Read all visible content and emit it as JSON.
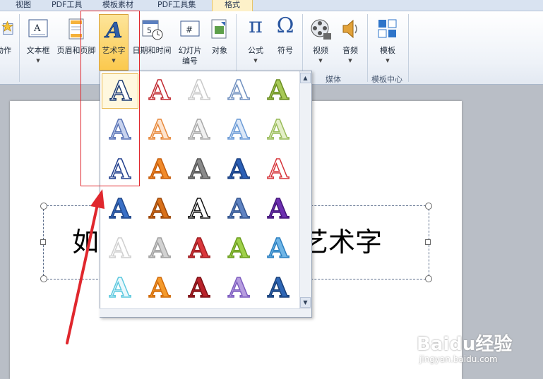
{
  "tabs": [
    {
      "label": "视图",
      "active": false
    },
    {
      "label": "PDF工具",
      "active": false
    },
    {
      "label": "模板素材",
      "active": false
    },
    {
      "label": "PDF工具集",
      "active": false
    },
    {
      "label": "格式",
      "active": true
    }
  ],
  "ribbon": {
    "partial_label": "动作",
    "buttons": [
      {
        "label": "文本框",
        "icon": "text-box-icon",
        "dropdown": true
      },
      {
        "label": "页眉和页脚",
        "icon": "header-footer-icon",
        "dropdown": false
      },
      {
        "label": "艺术字",
        "icon": "wordart-icon",
        "dropdown": true
      },
      {
        "label": "日期和时间",
        "icon": "date-time-icon",
        "dropdown": false
      },
      {
        "label": "幻灯片",
        "label2": "编号",
        "icon": "slide-number-icon",
        "dropdown": false
      },
      {
        "label": "对象",
        "icon": "object-icon",
        "dropdown": false
      },
      {
        "label": "公式",
        "icon": "equation-icon",
        "glyph": "π",
        "dropdown": true
      },
      {
        "label": "符号",
        "icon": "symbol-icon",
        "glyph": "Ω",
        "dropdown": false
      },
      {
        "label": "视频",
        "icon": "video-icon",
        "dropdown": true
      },
      {
        "label": "音频",
        "icon": "audio-icon",
        "dropdown": true
      },
      {
        "label": "模板",
        "icon": "template-icon",
        "dropdown": true
      }
    ],
    "groups": {
      "media": "媒体",
      "template_center": "模板中心"
    }
  },
  "gallery": {
    "glyph": "A",
    "selected_index": 0,
    "styles": [
      {
        "fill": "#ffffff",
        "stroke": "#1f3d73"
      },
      {
        "fill": "#ffffff",
        "stroke": "#c0272d"
      },
      {
        "fill": "#ffffff",
        "stroke": "#c9c9c9"
      },
      {
        "fill": "#ffffff",
        "stroke": "#6f8fbf"
      },
      {
        "fill": "#a7c957",
        "stroke": "#6b8e23"
      },
      {
        "fill": "#c8d3ee",
        "stroke": "#5a74b6"
      },
      {
        "fill": "#fde4cf",
        "stroke": "#e7893c"
      },
      {
        "fill": "#f0f0f0",
        "stroke": "#a8a8a8"
      },
      {
        "fill": "#dce8f8",
        "stroke": "#6c9bd6"
      },
      {
        "fill": "#e4efc8",
        "stroke": "#99bb5a"
      },
      {
        "fill": "#ffffff",
        "stroke": "#1f3d8c"
      },
      {
        "fill": "#f08a2b",
        "stroke": "#c65c0a"
      },
      {
        "fill": "#8a8a8a",
        "stroke": "#555555"
      },
      {
        "fill": "#2b5fb5",
        "stroke": "#1a3f80"
      },
      {
        "fill": "#ffffff",
        "stroke": "#d6343a"
      },
      {
        "fill": "#3a70c6",
        "stroke": "#20478a"
      },
      {
        "fill": "#d8701a",
        "stroke": "#9c4708"
      },
      {
        "fill": "#ffffff",
        "stroke": "#111111"
      },
      {
        "fill": "#5f83c2",
        "stroke": "#34558f"
      },
      {
        "fill": "#6c2fb0",
        "stroke": "#43157a"
      },
      {
        "fill": "#ffffff",
        "stroke": "#cfcfcf"
      },
      {
        "fill": "#d2d2d2",
        "stroke": "#a0a0a0"
      },
      {
        "fill": "#d9363b",
        "stroke": "#9d1d21"
      },
      {
        "fill": "#9fd049",
        "stroke": "#6a9c1e"
      },
      {
        "fill": "#6fb5e6",
        "stroke": "#2b7fc0"
      },
      {
        "fill": "#eaf8fc",
        "stroke": "#5ec9df"
      },
      {
        "fill": "#f49a2c",
        "stroke": "#d06a0a"
      },
      {
        "fill": "#b8222a",
        "stroke": "#7a1014"
      },
      {
        "fill": "#b69ddf",
        "stroke": "#7d5cbf"
      },
      {
        "fill": "#2e66b5",
        "stroke": "#183f78"
      }
    ]
  },
  "document": {
    "text_left": "如",
    "text_right": "艺术字"
  },
  "watermark": {
    "brand": "Baidu经验",
    "url": "jingyan.baidu.com"
  },
  "colors": {
    "highlight_box": "#e0272d",
    "arrow": "#e0272d"
  }
}
